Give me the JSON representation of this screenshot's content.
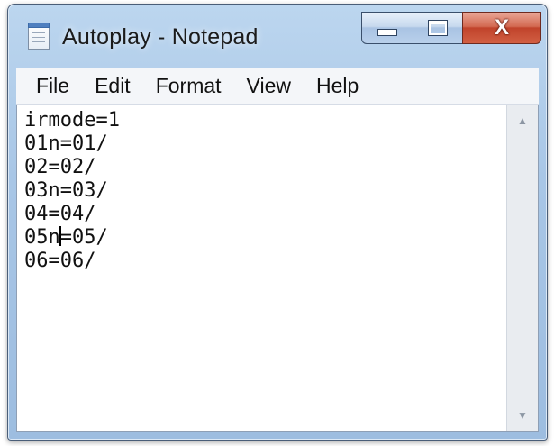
{
  "window": {
    "title": "Autoplay - Notepad",
    "icon": "notepad-icon",
    "controls": {
      "minimize": "minimize-icon",
      "maximize": "maximize-icon",
      "close": "close-icon",
      "close_glyph": "X"
    }
  },
  "menu": {
    "items": [
      "File",
      "Edit",
      "Format",
      "View",
      "Help"
    ]
  },
  "editor": {
    "lines": [
      "irmode=1",
      "01n=01/",
      "02=02/",
      "03n=03/",
      "04=04/",
      "05n=05/",
      "06=06/"
    ],
    "caret": {
      "line": 5,
      "column": 3
    }
  },
  "scrollbar": {
    "up_glyph": "▲",
    "down_glyph": "▼"
  },
  "colors": {
    "titlebar": "#a8c6e6",
    "close_button": "#c0432b",
    "editor_background": "#ffffff"
  }
}
